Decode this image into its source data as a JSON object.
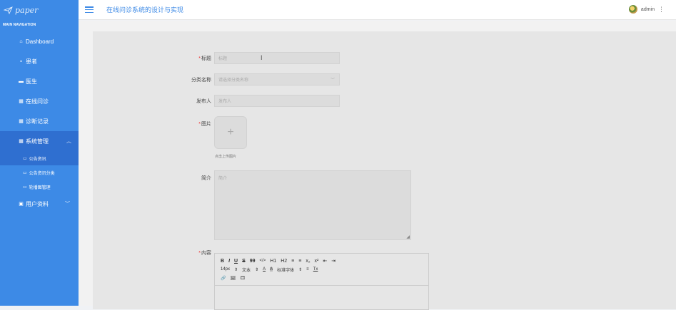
{
  "app": {
    "logo_text": "paper"
  },
  "sidebar": {
    "section_label": "MAIN NAVIGATION",
    "items": [
      {
        "label": "Dashboard",
        "icon": "home-icon"
      },
      {
        "label": "患者",
        "icon": "patient-icon"
      },
      {
        "label": "医生",
        "icon": "doctor-icon"
      },
      {
        "label": "在线问诊",
        "icon": "grid-icon"
      },
      {
        "label": "诊断记录",
        "icon": "grid-icon"
      },
      {
        "label": "系统管理",
        "icon": "grid-icon"
      }
    ],
    "sub_items": [
      {
        "label": "公告资讯",
        "icon": "folder-icon"
      },
      {
        "label": "公告资讯分类",
        "icon": "folder-icon"
      },
      {
        "label": "轮播图管理",
        "icon": "folder-icon"
      }
    ],
    "user_item": {
      "label": "用户资料",
      "icon": "calendar-icon"
    }
  },
  "header": {
    "title": "在线问诊系统的设计与实现",
    "user": "admin"
  },
  "form": {
    "title": {
      "label": "标题",
      "placeholder": "标题"
    },
    "category": {
      "label": "分类名称",
      "placeholder": "请选择分类名称"
    },
    "publisher": {
      "label": "发布人",
      "placeholder": "发布人"
    },
    "image": {
      "label": "图片",
      "tip": "点击上传图片"
    },
    "intro": {
      "label": "简介",
      "placeholder": "简介"
    },
    "content": {
      "label": "内容"
    }
  },
  "editor": {
    "row1": [
      "B",
      "I",
      "U",
      "S",
      "99",
      "</>",
      "H1",
      "H2",
      "≡",
      "≡",
      "x₂",
      "x²",
      "⇤",
      "⇥"
    ],
    "row2": [
      "14px",
      "文本",
      "A",
      "A",
      "标准字体",
      "≡",
      "Tx"
    ],
    "row3": [
      "🔗",
      "🖼",
      "🎞"
    ]
  }
}
